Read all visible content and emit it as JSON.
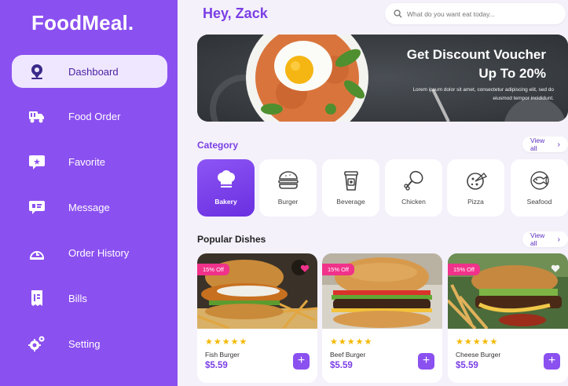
{
  "brand": {
    "name": "FoodMeal."
  },
  "sidebar": {
    "items": [
      {
        "label": "Dashboard",
        "icon": "dashboard-pin-icon",
        "active": true
      },
      {
        "label": "Food Order",
        "icon": "food-delivery-icon"
      },
      {
        "label": "Favorite",
        "icon": "favorite-star-icon"
      },
      {
        "label": "Message",
        "icon": "message-icon"
      },
      {
        "label": "Order History",
        "icon": "order-history-icon"
      },
      {
        "label": "Bills",
        "icon": "bills-icon"
      },
      {
        "label": "Setting",
        "icon": "gear-icon"
      }
    ]
  },
  "header": {
    "greeting": "Hey, Zack",
    "search_placeholder": "What do you want eat today..."
  },
  "banner": {
    "title": "Get Discount Voucher Up To 20%",
    "subtitle": "Lorem ipsum dolor sit amet, consectetur adipiscing elit, sed do eiusmod tempor incididunt."
  },
  "category": {
    "title": "Category",
    "view_all": "View all",
    "items": [
      {
        "label": "Bakery",
        "icon": "chef-hat-icon",
        "active": true
      },
      {
        "label": "Burger",
        "icon": "burger-icon"
      },
      {
        "label": "Beverage",
        "icon": "beverage-cup-icon"
      },
      {
        "label": "Chicken",
        "icon": "chicken-leg-icon"
      },
      {
        "label": "Pizza",
        "icon": "pizza-icon"
      },
      {
        "label": "Seafood",
        "icon": "fish-icon"
      }
    ]
  },
  "popular": {
    "title": "Popular Dishes",
    "view_all": "View all",
    "dishes": [
      {
        "name": "Fish Burger",
        "price": "$5.59",
        "discount": "15% Off",
        "rating": 5
      },
      {
        "name": "Beef Burger",
        "price": "$5.59",
        "discount": "15% Off",
        "rating": 5
      },
      {
        "name": "Cheese Burger",
        "price": "$5.59",
        "discount": "15% Off",
        "rating": 5
      }
    ]
  },
  "colors": {
    "sidebar": "#8b50f0",
    "accent": "#7b3fe4",
    "badge": "#f0328a",
    "star": "#f5b800",
    "background": "#f4f1fb"
  }
}
